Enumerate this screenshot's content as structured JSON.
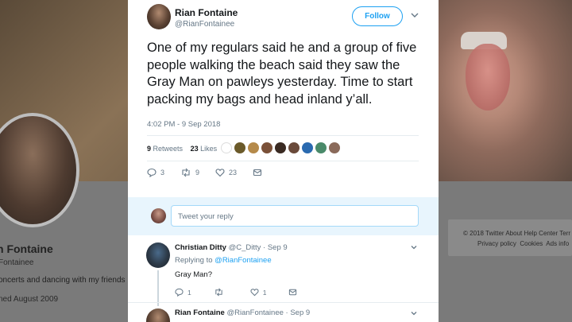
{
  "background_profile": {
    "name": "n Fontaine",
    "handle": "Fontainee",
    "bio": "oncerts and dancing with my friends :-)",
    "joined": "ned August 2009",
    "footer_links_row1": [
      "© 2018 Twitter",
      "About",
      "Help Center",
      "Terr"
    ],
    "footer_links_row2": [
      "Privacy policy",
      "Cookies",
      "Ads info"
    ]
  },
  "tweet": {
    "author_name": "Rian Fontaine",
    "author_handle": "@RianFontainee",
    "follow_label": "Follow",
    "text": "One of my regulars said he and a group of five people walking the beach said they saw the Gray Man on pawleys yesterday. Time to start packing my bags and head inland y’all.",
    "timestamp": "4:02 PM - 9 Sep 2018",
    "retweets_count": "9",
    "retweets_label": "Retweets",
    "likes_count": "23",
    "likes_label": "Likes",
    "actions": {
      "replies": "3",
      "retweets": "9",
      "likes": "23"
    }
  },
  "reply_box": {
    "placeholder": "Tweet your reply"
  },
  "replies": [
    {
      "name": "Christian Ditty",
      "handle": "@C_Ditty",
      "date": "· Sep 9",
      "replying_label": "Replying to",
      "replying_to": "@RianFontainee",
      "text": "Gray Man?",
      "actions": {
        "replies": "1",
        "retweets": "",
        "likes": "1"
      }
    },
    {
      "name": "Rian Fontaine",
      "handle": "@RianFontainee",
      "date": "· Sep 9"
    }
  ],
  "colors": {
    "accent": "#1da1f2",
    "secondary_text": "#657786",
    "reply_bar": "#e8f5fd"
  }
}
